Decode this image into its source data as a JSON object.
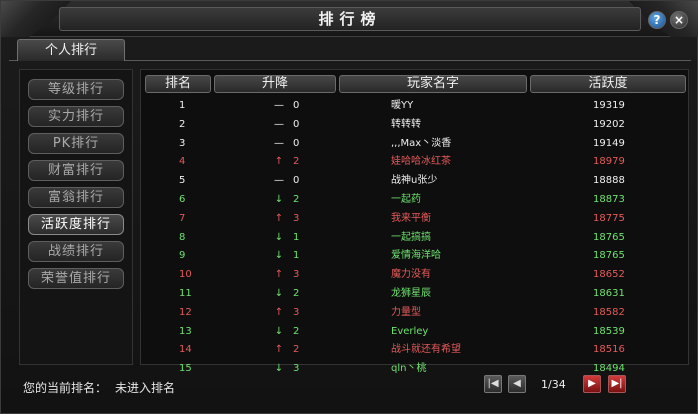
{
  "window": {
    "title": "排行榜"
  },
  "title_buttons": {
    "help": "?",
    "close": "×"
  },
  "tabs": [
    {
      "label": "个人排行"
    }
  ],
  "sidebar": {
    "items": [
      {
        "label": "等级排行",
        "active": false
      },
      {
        "label": "实力排行",
        "active": false
      },
      {
        "label": "PK排行",
        "active": false
      },
      {
        "label": "财富排行",
        "active": false
      },
      {
        "label": "富翁排行",
        "active": false
      },
      {
        "label": "活跃度排行",
        "active": true
      },
      {
        "label": "战绩排行",
        "active": false
      },
      {
        "label": "荣誉值排行",
        "active": false
      }
    ]
  },
  "table": {
    "headers": {
      "rank": "排名",
      "change": "升降",
      "name": "玩家名字",
      "activity": "活跃度"
    },
    "rows": [
      {
        "rank": "1",
        "arrow": "—",
        "delta": "0",
        "name": "暖YY",
        "activity": "19319",
        "color": "white"
      },
      {
        "rank": "2",
        "arrow": "—",
        "delta": "0",
        "name": "转转转",
        "activity": "19202",
        "color": "white"
      },
      {
        "rank": "3",
        "arrow": "—",
        "delta": "0",
        "name": ",,,Max丶淡香",
        "activity": "19149",
        "color": "white"
      },
      {
        "rank": "4",
        "arrow": "↑",
        "delta": "2",
        "name": "娃哈哈冰红茶",
        "activity": "18979",
        "color": "red"
      },
      {
        "rank": "5",
        "arrow": "—",
        "delta": "0",
        "name": "战神u张少",
        "activity": "18888",
        "color": "white"
      },
      {
        "rank": "6",
        "arrow": "↓",
        "delta": "2",
        "name": "一起药",
        "activity": "18873",
        "color": "green"
      },
      {
        "rank": "7",
        "arrow": "↑",
        "delta": "3",
        "name": "我来平衡",
        "activity": "18775",
        "color": "red"
      },
      {
        "rank": "8",
        "arrow": "↓",
        "delta": "1",
        "name": "一起搞搞",
        "activity": "18765",
        "color": "green"
      },
      {
        "rank": "9",
        "arrow": "↓",
        "delta": "1",
        "name": "爱情海洋哈",
        "activity": "18765",
        "color": "green"
      },
      {
        "rank": "10",
        "arrow": "↑",
        "delta": "3",
        "name": "魔力没有",
        "activity": "18652",
        "color": "red"
      },
      {
        "rank": "11",
        "arrow": "↓",
        "delta": "2",
        "name": "龙狮星辰",
        "activity": "18631",
        "color": "green"
      },
      {
        "rank": "12",
        "arrow": "↑",
        "delta": "3",
        "name": "力量型",
        "activity": "18582",
        "color": "red"
      },
      {
        "rank": "13",
        "arrow": "↓",
        "delta": "2",
        "name": "Everley",
        "activity": "18539",
        "color": "green"
      },
      {
        "rank": "14",
        "arrow": "↑",
        "delta": "2",
        "name": "战斗就还有希望",
        "activity": "18516",
        "color": "red"
      },
      {
        "rank": "15",
        "arrow": "↓",
        "delta": "3",
        "name": "qln丶桃",
        "activity": "18494",
        "color": "green"
      }
    ]
  },
  "footer": {
    "label": "您的当前排名：",
    "value": "未进入排名"
  },
  "pager": {
    "first": "|◀",
    "prev": "◀",
    "page_text": "1/34",
    "next": "▶",
    "last": "▶|"
  },
  "colors": {
    "up": "#e45a5a",
    "down": "#6ee26e",
    "same": "#f0f0f0"
  }
}
